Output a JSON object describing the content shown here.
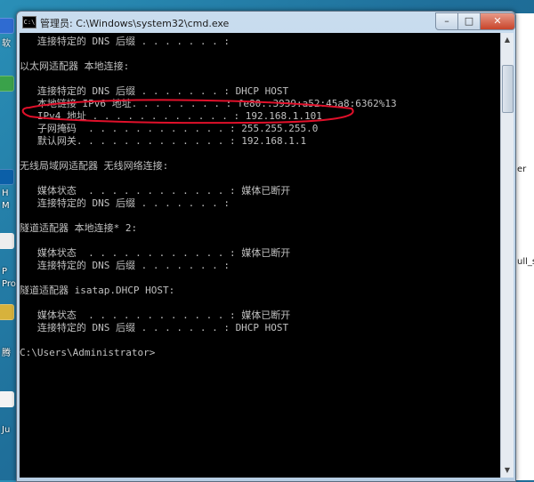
{
  "window": {
    "title": "管理员: C:\\Windows\\system32\\cmd.exe",
    "icon": "C:\\"
  },
  "desktop": {
    "labels": [
      "软",
      "H",
      "M",
      "P",
      "Pro",
      "腾",
      "Ju"
    ]
  },
  "background_window": {
    "texts": [
      "er",
      "ull_s"
    ]
  },
  "console": {
    "lines": [
      "   连接特定的 DNS 后缀 . . . . . . . :",
      "",
      "以太网适配器 本地连接:",
      "",
      "   连接特定的 DNS 后缀 . . . . . . . : DHCP HOST",
      "   本地链接 IPv6 地址. . . . . . . . : fe80::3939:a52:45a8:6362%13",
      "   IPv4 地址 . . . . . . . . . . . . : 192.168.1.101",
      "   子网掩码  . . . . . . . . . . . . : 255.255.255.0",
      "   默认网关. . . . . . . . . . . . . : 192.168.1.1",
      "",
      "无线局域网适配器 无线网络连接:",
      "",
      "   媒体状态  . . . . . . . . . . . . : 媒体已断开",
      "   连接特定的 DNS 后缀 . . . . . . . :",
      "",
      "隧道适配器 本地连接* 2:",
      "",
      "   媒体状态  . . . . . . . . . . . . : 媒体已断开",
      "   连接特定的 DNS 后缀 . . . . . . . :",
      "",
      "隧道适配器 isatap.DHCP HOST:",
      "",
      "   媒体状态  . . . . . . . . . . . . : 媒体已断开",
      "   连接特定的 DNS 后缀 . . . . . . . : DHCP HOST",
      "",
      "C:\\Users\\Administrator>"
    ]
  },
  "colors": {
    "console_bg": "#000000",
    "console_text": "#c0c0c0",
    "annotation": "#e0102a"
  },
  "icons": {
    "app": "cmd-icon",
    "minimize": "minimize-icon",
    "maximize": "maximize-icon",
    "close": "close-icon"
  }
}
